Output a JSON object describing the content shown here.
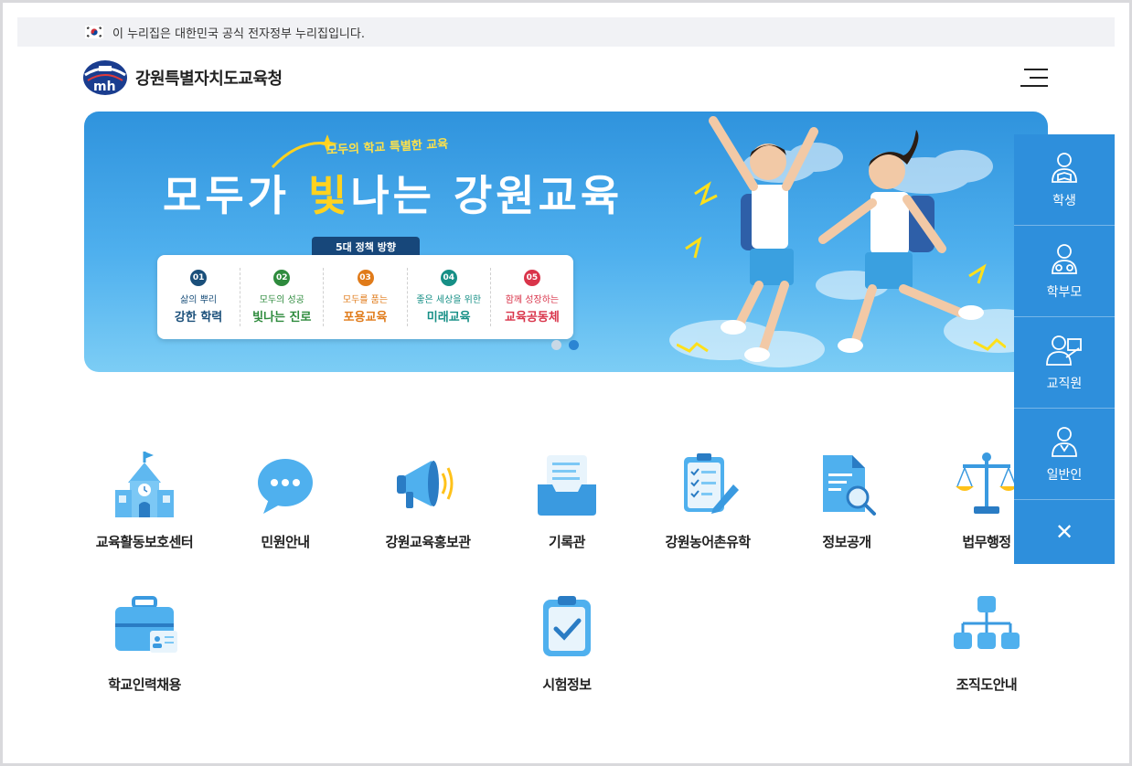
{
  "gov_bar": {
    "text": "이 누리집은 대한민국 공식 전자정부 누리집입니다."
  },
  "header": {
    "org_name": "강원특별자치도교육청",
    "logo_icon": "gangwon-edu-logo-icon",
    "menu_icon": "hamburger-menu-icon"
  },
  "banner": {
    "subtitle": "모두의 학교 특별한 교육",
    "title_part1": "모두가 ",
    "title_highlight": "빛",
    "title_part2": "나는 강원교육",
    "policy_tag": "5대 정책 방향",
    "policies": [
      {
        "num": "01",
        "small": "삶의 뿌리",
        "big": "강한 학력",
        "color": "#1a4f7a"
      },
      {
        "num": "02",
        "small": "모두의 성공",
        "big": "빛나는 진로",
        "color": "#2e8b3d"
      },
      {
        "num": "03",
        "small": "모두를 품는",
        "big": "포용교육",
        "color": "#e07b1a"
      },
      {
        "num": "04",
        "small": "좋은 세상을 위한",
        "big": "미래교육",
        "color": "#168f86"
      },
      {
        "num": "05",
        "small": "함께 성장하는",
        "big": "교육공동체",
        "color": "#d9344a"
      }
    ],
    "slide_total": 2,
    "slide_active": 2
  },
  "menu": [
    {
      "label": "교육활동보호센터",
      "icon": "school-building-icon"
    },
    {
      "label": "민원안내",
      "icon": "speech-bubble-icon"
    },
    {
      "label": "강원교육홍보관",
      "icon": "megaphone-icon"
    },
    {
      "label": "기록관",
      "icon": "document-tray-icon"
    },
    {
      "label": "강원농어촌유학",
      "icon": "checklist-clipboard-icon"
    },
    {
      "label": "정보공개",
      "icon": "document-search-icon"
    },
    {
      "label": "법무행정",
      "icon": "scales-icon"
    },
    {
      "label": "학교인력채용",
      "icon": "briefcase-icon"
    },
    {
      "label": "시험정보",
      "icon": "clipboard-check-icon"
    },
    {
      "label": "조직도안내",
      "icon": "org-chart-icon"
    }
  ],
  "side_panel": {
    "items": [
      {
        "label": "학생",
        "icon": "student-icon"
      },
      {
        "label": "학부모",
        "icon": "parent-icon"
      },
      {
        "label": "교직원",
        "icon": "teacher-icon"
      },
      {
        "label": "일반인",
        "icon": "citizen-icon"
      }
    ],
    "close_label": "✕"
  },
  "colors": {
    "accent": "#2e8fdc",
    "banner_highlight": "#ffd21f",
    "gov_bar_bg": "#f1f2f5"
  }
}
